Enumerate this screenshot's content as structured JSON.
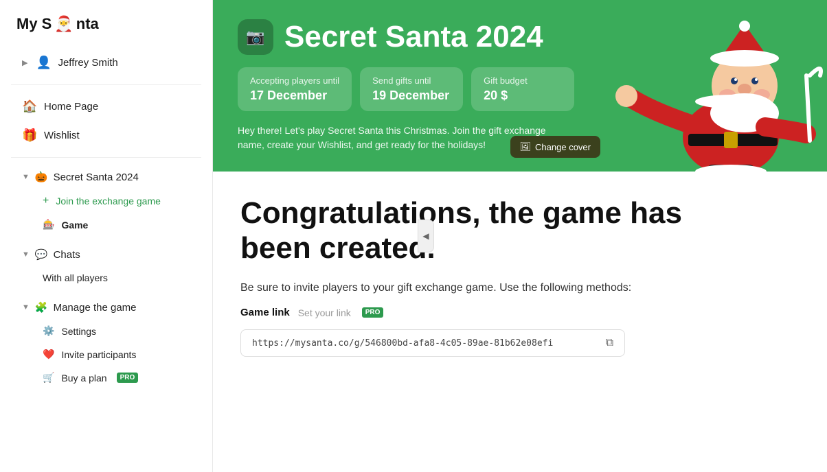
{
  "logo": {
    "text": "My S",
    "icon": "🎅",
    "text2": "nta"
  },
  "sidebar": {
    "collapse_icon": "◀",
    "user": {
      "label": "Jeffrey Smith",
      "icon": "👤"
    },
    "items": [
      {
        "id": "home",
        "label": "Home Page",
        "icon": "🏠"
      },
      {
        "id": "wishlist",
        "label": "Wishlist",
        "icon": "🎁"
      }
    ],
    "secret_santa_group": {
      "label": "Secret Santa 2024",
      "icon": "🎃",
      "chevron": "▼"
    },
    "join_label": "Join the exchange game",
    "join_icon": "+",
    "game_label": "Game",
    "game_icon": "🎰",
    "chats_group": {
      "label": "Chats",
      "icon": "💬",
      "chevron": "▼"
    },
    "with_all_players": "With all players",
    "manage_group": {
      "label": "Manage the game",
      "icon": "🧩",
      "chevron": "▼"
    },
    "settings_label": "Settings",
    "settings_icon": "⚙️",
    "invite_label": "Invite participants",
    "invite_icon": "❤️",
    "buy_plan_label": "Buy a plan",
    "buy_plan_icon": "🛒",
    "pro_badge": "PRO"
  },
  "hero": {
    "title": "Secret Santa 2024",
    "camera_icon": "📷",
    "card1_label": "Accepting players until",
    "card1_value": "17 December",
    "card2_label": "Send gifts until",
    "card2_value": "19 December",
    "card3_label": "Gift budget",
    "card3_value": "20 $",
    "description": "Hey there! Let's play Secret Santa this Christmas. Join the gift exchange name, create your Wishlist, and get ready for the holidays!",
    "change_cover_label": "Change cover",
    "image_icon": "🖼"
  },
  "content": {
    "congrats_title": "Congratulations, the game has been created.",
    "invite_desc": "Be sure to invite players to your gift exchange game. Use the following methods:",
    "game_link_label": "Game link",
    "set_link_text": "Set your link",
    "pro_badge": "PRO",
    "game_url": "https://mysanta.co/g/546800bd-afa8-4c05-89ae-81b62e08efi",
    "copy_icon": "⧉"
  }
}
